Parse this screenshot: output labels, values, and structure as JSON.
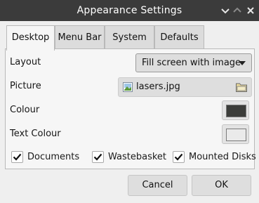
{
  "window": {
    "title": "Appearance Settings",
    "controls": [
      "chevron-down-icon",
      "chevron-up-icon",
      "close-icon"
    ]
  },
  "tabs": [
    {
      "label": "Desktop",
      "active": true
    },
    {
      "label": "Menu Bar",
      "active": false
    },
    {
      "label": "System",
      "active": false
    },
    {
      "label": "Defaults",
      "active": false
    }
  ],
  "desktop": {
    "layout_label": "Layout",
    "layout_value": "Fill screen with image",
    "picture_label": "Picture",
    "picture_value": "lasers.jpg",
    "colour_label": "Colour",
    "colour_value": "#3c3d3a",
    "text_colour_label": "Text Colour",
    "text_colour_value": "#eaeaea",
    "checkboxes": [
      {
        "label": "Documents",
        "checked": true
      },
      {
        "label": "Wastebasket",
        "checked": true
      },
      {
        "label": "Mounted Disks",
        "checked": true
      }
    ]
  },
  "buttons": {
    "cancel": "Cancel",
    "ok": "OK"
  },
  "colors": {
    "titlebar_bg": "#3b3b3b",
    "window_bg": "#efefef",
    "panel_bg": "#f6f6f6"
  }
}
